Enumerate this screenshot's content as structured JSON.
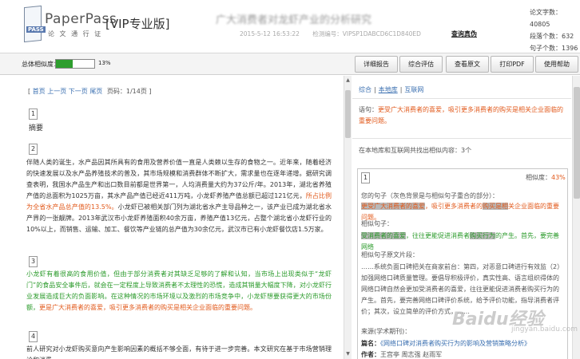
{
  "header": {
    "brand": "PaperPass",
    "brand_sub": "论 文 通 行 证",
    "logo_tag": "PASS",
    "edition": "[VIP专业版]",
    "doc_title": "广大消费者对龙虾产业的分析研究",
    "date": "2015-5-12 16:53:22",
    "check_no": "检测编号：VIPSP1DABCD6C1D840ED",
    "verify_link": "查询真伪",
    "stats": [
      "论文字数：40805",
      "段落个数：632",
      "句子个数：1396"
    ]
  },
  "toolbar": {
    "similarity_label": "总体相似度：",
    "similarity_value": 43,
    "similarity_text": "13%",
    "buttons": [
      "详细报告",
      "综合评估",
      "查看原文",
      "打印PDF",
      "使用帮助"
    ]
  },
  "left": {
    "nav": [
      "首页",
      "上一页",
      "下一页",
      "尾页"
    ],
    "page_info": "页码：1/14页",
    "sections": [
      {
        "num": "1",
        "title": "摘要"
      },
      {
        "num": "2"
      },
      {
        "num": "3"
      },
      {
        "num": "4"
      }
    ],
    "para2": {
      "a": "伴随人类的诞生，水产品因其所具有的食用及营养价值一直是人类赖以生存的食物之一。近年来，随着经济的快速发展以及水产品养殖技术的普及，其市场规模和消费群体不断扩大，需求量也在逐年递增。据研究调查表明，我国水产品生产和出口数目前都是世界第一，人均消费量大约为37公斤/年。2013年，湖北省养殖产值的总面积为1025万亩，其水产品产值已经近411万吨，小龙虾养殖产值总额已超过121亿元，",
      "b": "所占比例为全省水产品总产值的13.5%。",
      "c": "小龙虾已被相关部门列为湖北省水产主导品种之一，该产业已成为湖北省水产界的一张靓牌。2013年武汉市小龙虾养殖面积40余万亩，养殖产值13亿元，占整个湖北省小龙虾行业的10%以上，而销售、运输、加工、餐饮等产业链的总产值为30余亿元，武汉市已有小龙虾餐饮店1.5万家。"
    },
    "para3": {
      "a": "小龙虾有着很高的食用价值，但由于部分消费者对其缺乏足够的了解和认知，当市场上出现类似于“龙虾门”的食品安全事件后，就会在一定程度上导致消费者不太理性的恐慌，造成其销量大幅度下降，对小龙虾行业发展造成巨大的负面影响。在这种情况的市场环境以及激烈的市场竞争中，小龙虾想要获得更大的市场份额，",
      "b": "更是广大消费者的喜爱，吸引更多消费者的购买是相关企业面临的重要问题。"
    },
    "para4": "前人研究对小龙虾购买意向产生影响因素的概括不够全面，有待于进一步完善。本文研究在基于市场营销理论和消费"
  },
  "right": {
    "tabs": [
      "综合",
      "本地库",
      "互联网"
    ],
    "sentence_label": "语句：",
    "sentence": "更受广大消费者的喜爱，吸引更多消费者的购买是相关企业面临的重要问题。",
    "found_text": "在本地库和互联网共找出相似内容：3个",
    "result_num": "1",
    "similarity_label": "相似度：",
    "similarity_value": "43%",
    "your_sentence_label": "您的句子（灰色背景是与相似句子重合的部分）：",
    "your_sentence_hl1": "更受广大消费者的喜爱",
    "your_sentence_mid": "，吸引更多消费者的",
    "your_sentence_hl2": "购买是相",
    "your_sentence_end": "关企业面临的重要问题。",
    "similar_label": "相似句子：",
    "similar_hl1": "受消费者的喜爱",
    "similar_mid": "，往往更能促进消费者",
    "similar_hl2": "购买行为",
    "similar_end": "的产生。首先，要完善网络",
    "context_label": "相似句子原文片段：",
    "context": "……系统负面口碑把关在商家前台：第四，对恶意口碑进行有效监（2）加强网络口碑质量管理。要倡导积极评价，真实性高、语言组织得体的网络口碑自然会更加受消费者的喜爱，往往更能促进消费者购买行为的产生。首先，要完善网络口碑评价系统，给予评价功能，指导消费者评价；其次，设立简单的评价方式，……",
    "source_label": "来源(学术期刊)：",
    "title_label": "篇名：",
    "title": "《网络口碑对消费者购买行为的影响及营销策略分析》",
    "author_label": "作者：",
    "author": "王宫亭 周志强 赵雨军"
  },
  "watermark": "Baidu经验",
  "watermark_sub": "jingyan.baidu.com"
}
